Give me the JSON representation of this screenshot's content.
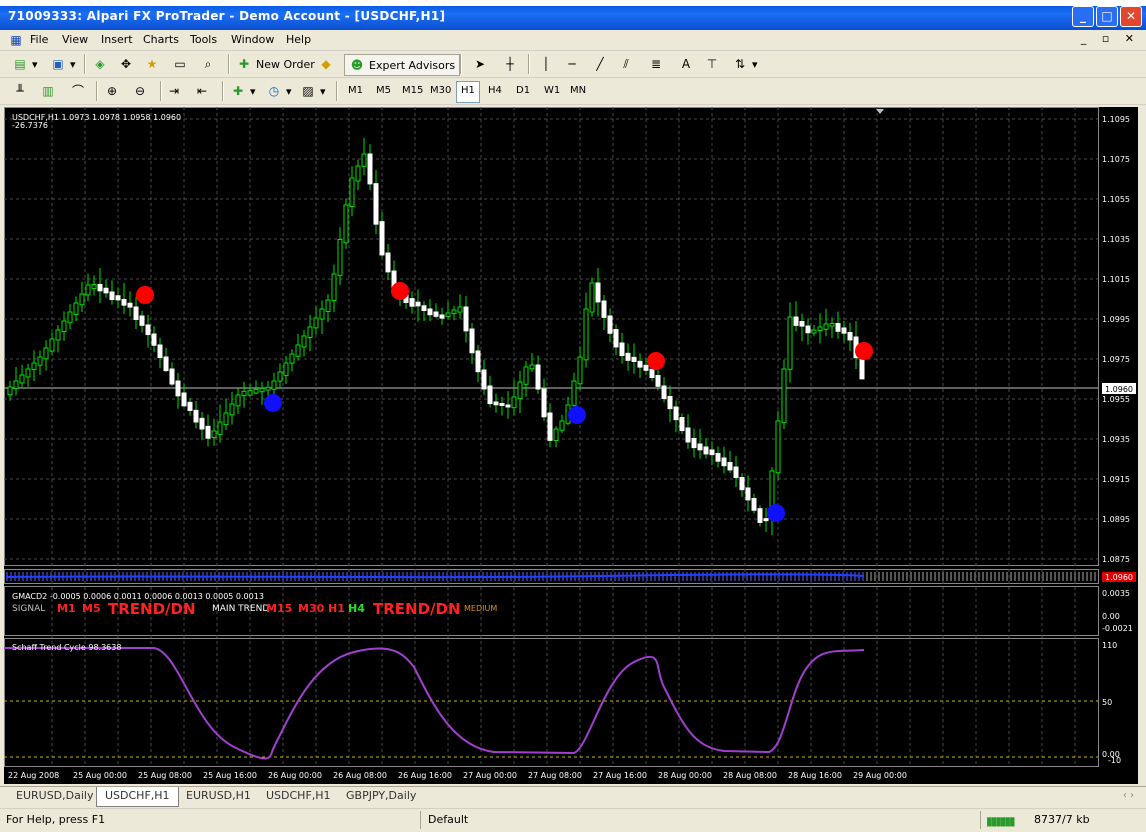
{
  "window": {
    "title": "71009333: Alpari FX ProTrader - Demo Account - [USDCHF,H1]"
  },
  "menu": {
    "items": [
      "File",
      "View",
      "Insert",
      "Charts",
      "Tools",
      "Window",
      "Help"
    ],
    "mdi_controls": "_ ▫ ✕"
  },
  "toolbar1": {
    "new_order": "New Order",
    "expert_advisors": "Expert Advisors",
    "text_tool": "A"
  },
  "toolbar2": {
    "timeframes": [
      "M1",
      "M5",
      "M15",
      "M30",
      "H1",
      "H4",
      "D1",
      "W1",
      "MN"
    ],
    "active_timeframe": "H1"
  },
  "chart": {
    "header": "USDCHF,H1  1.0973 1.0978 1.0958 1.0960",
    "sub_header": "-26.7376",
    "price_ticks": [
      "1.1095",
      "1.1075",
      "1.1055",
      "1.1035",
      "1.1015",
      "1.0995",
      "1.0975",
      "1.0955",
      "1.0935",
      "1.0915",
      "1.0895",
      "1.0875"
    ],
    "current_price": "1.0960",
    "strip_price": "1.0960",
    "time_labels": [
      "22 Aug 2008",
      "25 Aug 00:00",
      "25 Aug 08:00",
      "25 Aug 16:00",
      "26 Aug 00:00",
      "26 Aug 08:00",
      "26 Aug 16:00",
      "27 Aug 00:00",
      "27 Aug 08:00",
      "27 Aug 16:00",
      "28 Aug 00:00",
      "28 Aug 08:00",
      "28 Aug 16:00",
      "29 Aug 00:00"
    ],
    "colors": {
      "background": "#000000",
      "grid": "#4a4a4a",
      "bull": "#00e000",
      "bear": "#ffffff",
      "sell_dot": "#ff0000",
      "buy_dot": "#1010ff",
      "stc_line": "#a040d0",
      "stc_level": "#c8b400"
    }
  },
  "gmacd": {
    "header": "GMACD2 -0.0005 0.0006 0.0011 0.0006 0.0013 0.0005 0.0013",
    "signal_label": "SIGNAL",
    "m1": "M1",
    "m5": "M5",
    "trend1": "TREND/DN",
    "main_trend_label": "MAIN TREND",
    "m15": "M15",
    "m30": "M30",
    "h1": "H1",
    "h4": "H4",
    "trend2": "TREND/DN",
    "strength": "MEDIUM",
    "ticks": [
      "0.0035",
      "0.00",
      "-0.0021"
    ]
  },
  "stc": {
    "header": "Schaff Trend Cycle 98.3638",
    "ticks": [
      "110",
      "50",
      "0.00",
      "-10"
    ],
    "upper_val": "110"
  },
  "tabs": [
    "EURUSD,Daily",
    "USDCHF,H1",
    "EURUSD,H1",
    "USDCHF,H1",
    "GBPJPY,Daily"
  ],
  "active_tab": "USDCHF,H1",
  "status": {
    "help": "For Help, press F1",
    "profile": "Default",
    "traffic": "8737/7 kb"
  }
}
